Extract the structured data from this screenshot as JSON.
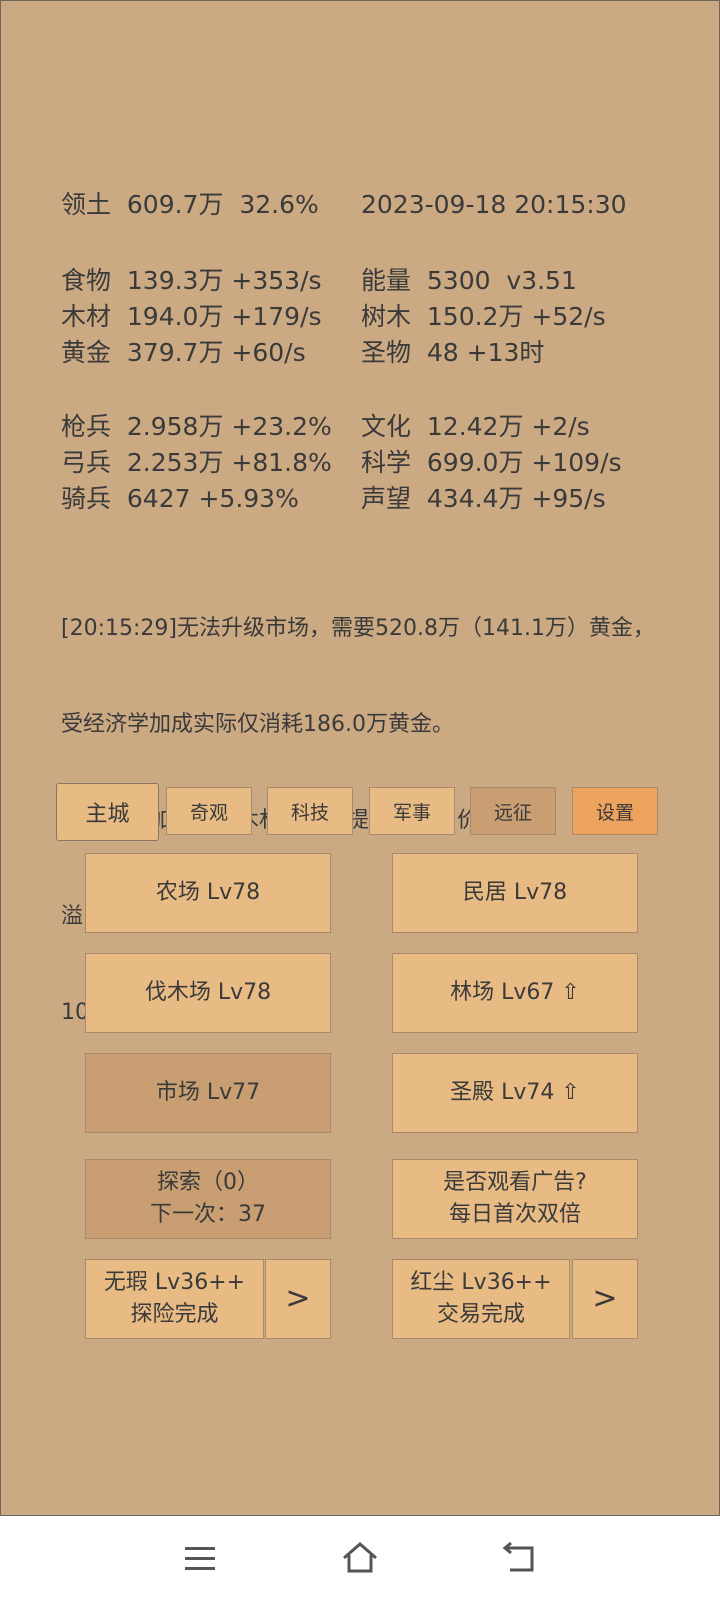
{
  "stats": {
    "territory": "领土  609.7万  32.6%",
    "datetime": "2023-09-18 20:15:30",
    "food": "食物  139.3万 +353/s",
    "energy": "能量  5300  v3.51",
    "wood": "木材  194.0万 +179/s",
    "trees": "树木  150.2万 +52/s",
    "gold": "黄金  379.7万 +60/s",
    "relics": "圣物  48 +13时",
    "spearmen": "枪兵  2.958万 +23.2%",
    "culture": "文化  12.42万 +2/s",
    "archers": "弓兵  2.253万 +81.8%",
    "science": "科学  699.0万 +109/s",
    "cavalry": "骑兵  6427 +5.93%",
    "prestige": "声望  434.4万 +95/s"
  },
  "log": {
    "line1": "[20:15:29]无法升级市场，需要520.8万（141.1万）黄金，",
    "line2": "受经济学加成实际仅消耗186.0万黄金。",
    "line3": "市场：增加食物和木材收入，提升图纸售价。",
    "line4": "溢出的黄金会生产骑兵。",
    "line5": "100级后自动合成效率加倍。"
  },
  "tabs": {
    "main": "主城",
    "wonders": "奇观",
    "tech": "科技",
    "military": "军事",
    "expedition": "远征",
    "settings": "设置"
  },
  "buildings": {
    "farm": "农场 Lv78",
    "house": "民居 Lv78",
    "lumber": "伐木场 Lv78",
    "forest": "林场 Lv67 ⇧",
    "market": "市场 Lv77",
    "temple": "圣殿 Lv74 ⇧"
  },
  "explore": {
    "line1": "探索（0）",
    "line2": "下一次：37"
  },
  "ad": {
    "line1": "是否观看广告?",
    "line2": "每日首次双倍"
  },
  "hero1": {
    "line1": "无瑕 Lv36++",
    "line2": "探险完成",
    "arrow": ">"
  },
  "hero2": {
    "line1": "红尘 Lv36++",
    "line2": "交易完成",
    "arrow": ">"
  },
  "icons": {
    "menu": "menu-icon",
    "home": "home-icon",
    "back": "back-icon"
  }
}
